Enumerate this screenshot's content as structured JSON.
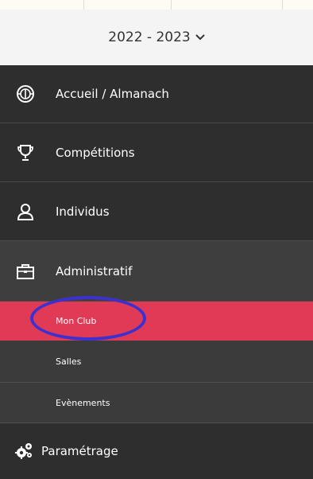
{
  "season": {
    "label": "2022 - 2023",
    "icon": "chevron-down-icon"
  },
  "menu": {
    "items": [
      {
        "label": "Accueil / Almanach",
        "icon": "volleyball-icon"
      },
      {
        "label": "Compétitions",
        "icon": "trophy-icon"
      },
      {
        "label": "Individus",
        "icon": "user-icon"
      },
      {
        "label": "Administratif",
        "icon": "briefcase-icon"
      },
      {
        "label": "Paramétrage",
        "icon": "gears-icon"
      }
    ],
    "subitems": [
      {
        "label": "Mon Club"
      },
      {
        "label": "Salles"
      },
      {
        "label": "Evènements"
      }
    ]
  },
  "colors": {
    "selected": "#e03a57",
    "sidebar_bg": "#2e2e2e",
    "annotation": "#3c31cf"
  }
}
